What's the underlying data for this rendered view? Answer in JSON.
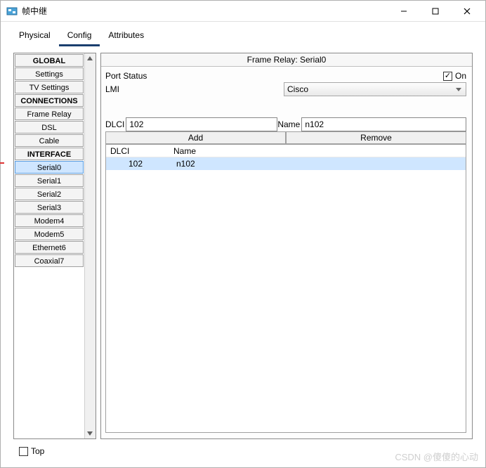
{
  "window": {
    "title": "帧中继",
    "controls": {
      "min": "—",
      "max": "▢",
      "close": "✕"
    }
  },
  "tabs": [
    {
      "label": "Physical",
      "active": false
    },
    {
      "label": "Config",
      "active": true
    },
    {
      "label": "Attributes",
      "active": false
    }
  ],
  "sidebar": {
    "groups": [
      {
        "header": "GLOBAL",
        "items": [
          "Settings",
          "TV Settings"
        ]
      },
      {
        "header": "CONNECTIONS",
        "items": [
          "Frame Relay",
          "DSL",
          "Cable"
        ]
      },
      {
        "header": "INTERFACE",
        "items": [
          "Serial0",
          "Serial1",
          "Serial2",
          "Serial3",
          "Modem4",
          "Modem5",
          "Ethernet6",
          "Coaxial7"
        ]
      }
    ],
    "selected": "Serial0"
  },
  "panel": {
    "title": "Frame Relay: Serial0",
    "port_status_label": "Port Status",
    "port_status_on_label": "On",
    "port_status_checked": true,
    "lmi_label": "LMI",
    "lmi_value": "Cisco",
    "dlci_label": "DLCI",
    "dlci_value": "102",
    "name_label": "Name",
    "name_value": "n102",
    "add_btn": "Add",
    "remove_btn": "Remove",
    "table": {
      "cols": [
        "DLCI",
        "Name"
      ],
      "rows": [
        {
          "dlci": "102",
          "name": "n102",
          "selected": true
        }
      ]
    }
  },
  "bottom": {
    "top_label": "Top",
    "top_checked": false
  },
  "watermark": "CSDN @傻傻的心动"
}
